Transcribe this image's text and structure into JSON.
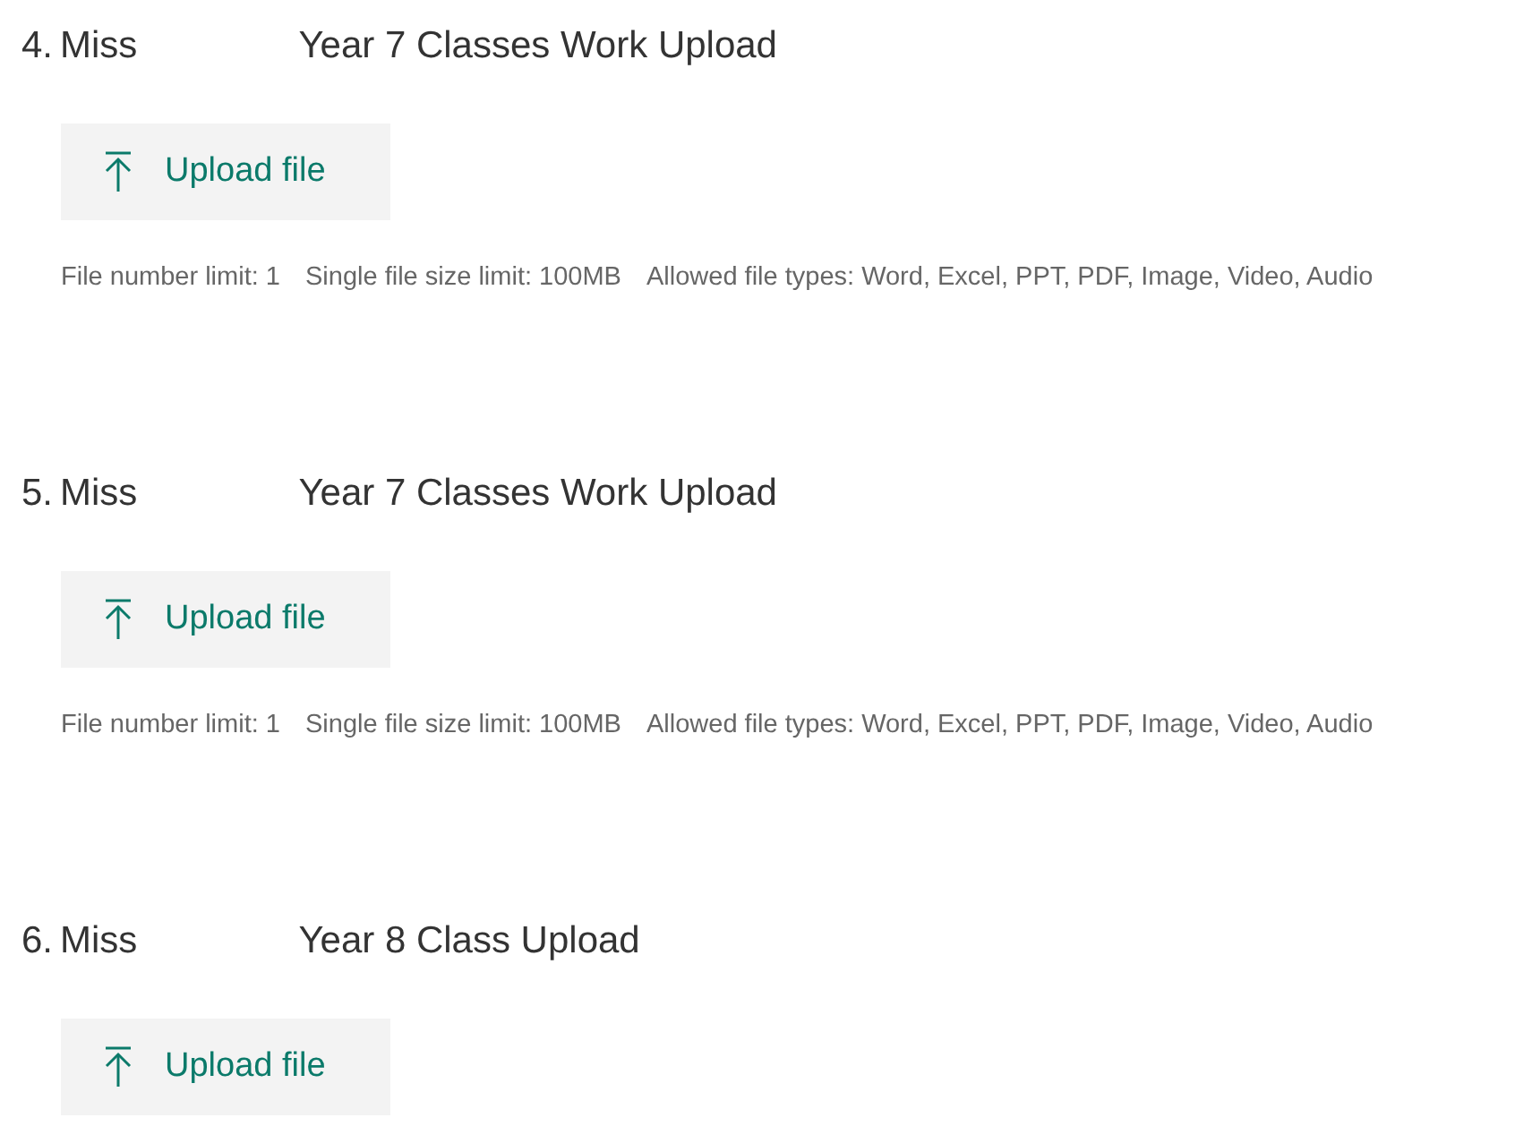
{
  "questions": [
    {
      "number": "4.",
      "title_parts": [
        "Miss",
        "Year 7 Classes Work Upload"
      ],
      "button": "Upload file",
      "limits": [
        "File number limit: 1",
        "Single file size limit: 100MB",
        "Allowed file types: Word, Excel, PPT, PDF, Image, Video, Audio"
      ]
    },
    {
      "number": "5.",
      "title_parts": [
        "Miss",
        "Year 7 Classes Work Upload"
      ],
      "button": "Upload file",
      "limits": [
        "File number limit: 1",
        "Single file size limit: 100MB",
        "Allowed file types: Word, Excel, PPT, PDF, Image, Video, Audio"
      ]
    },
    {
      "number": "6.",
      "title_parts": [
        "Miss",
        "Year 8 Class Upload"
      ],
      "button": "Upload file"
    }
  ]
}
